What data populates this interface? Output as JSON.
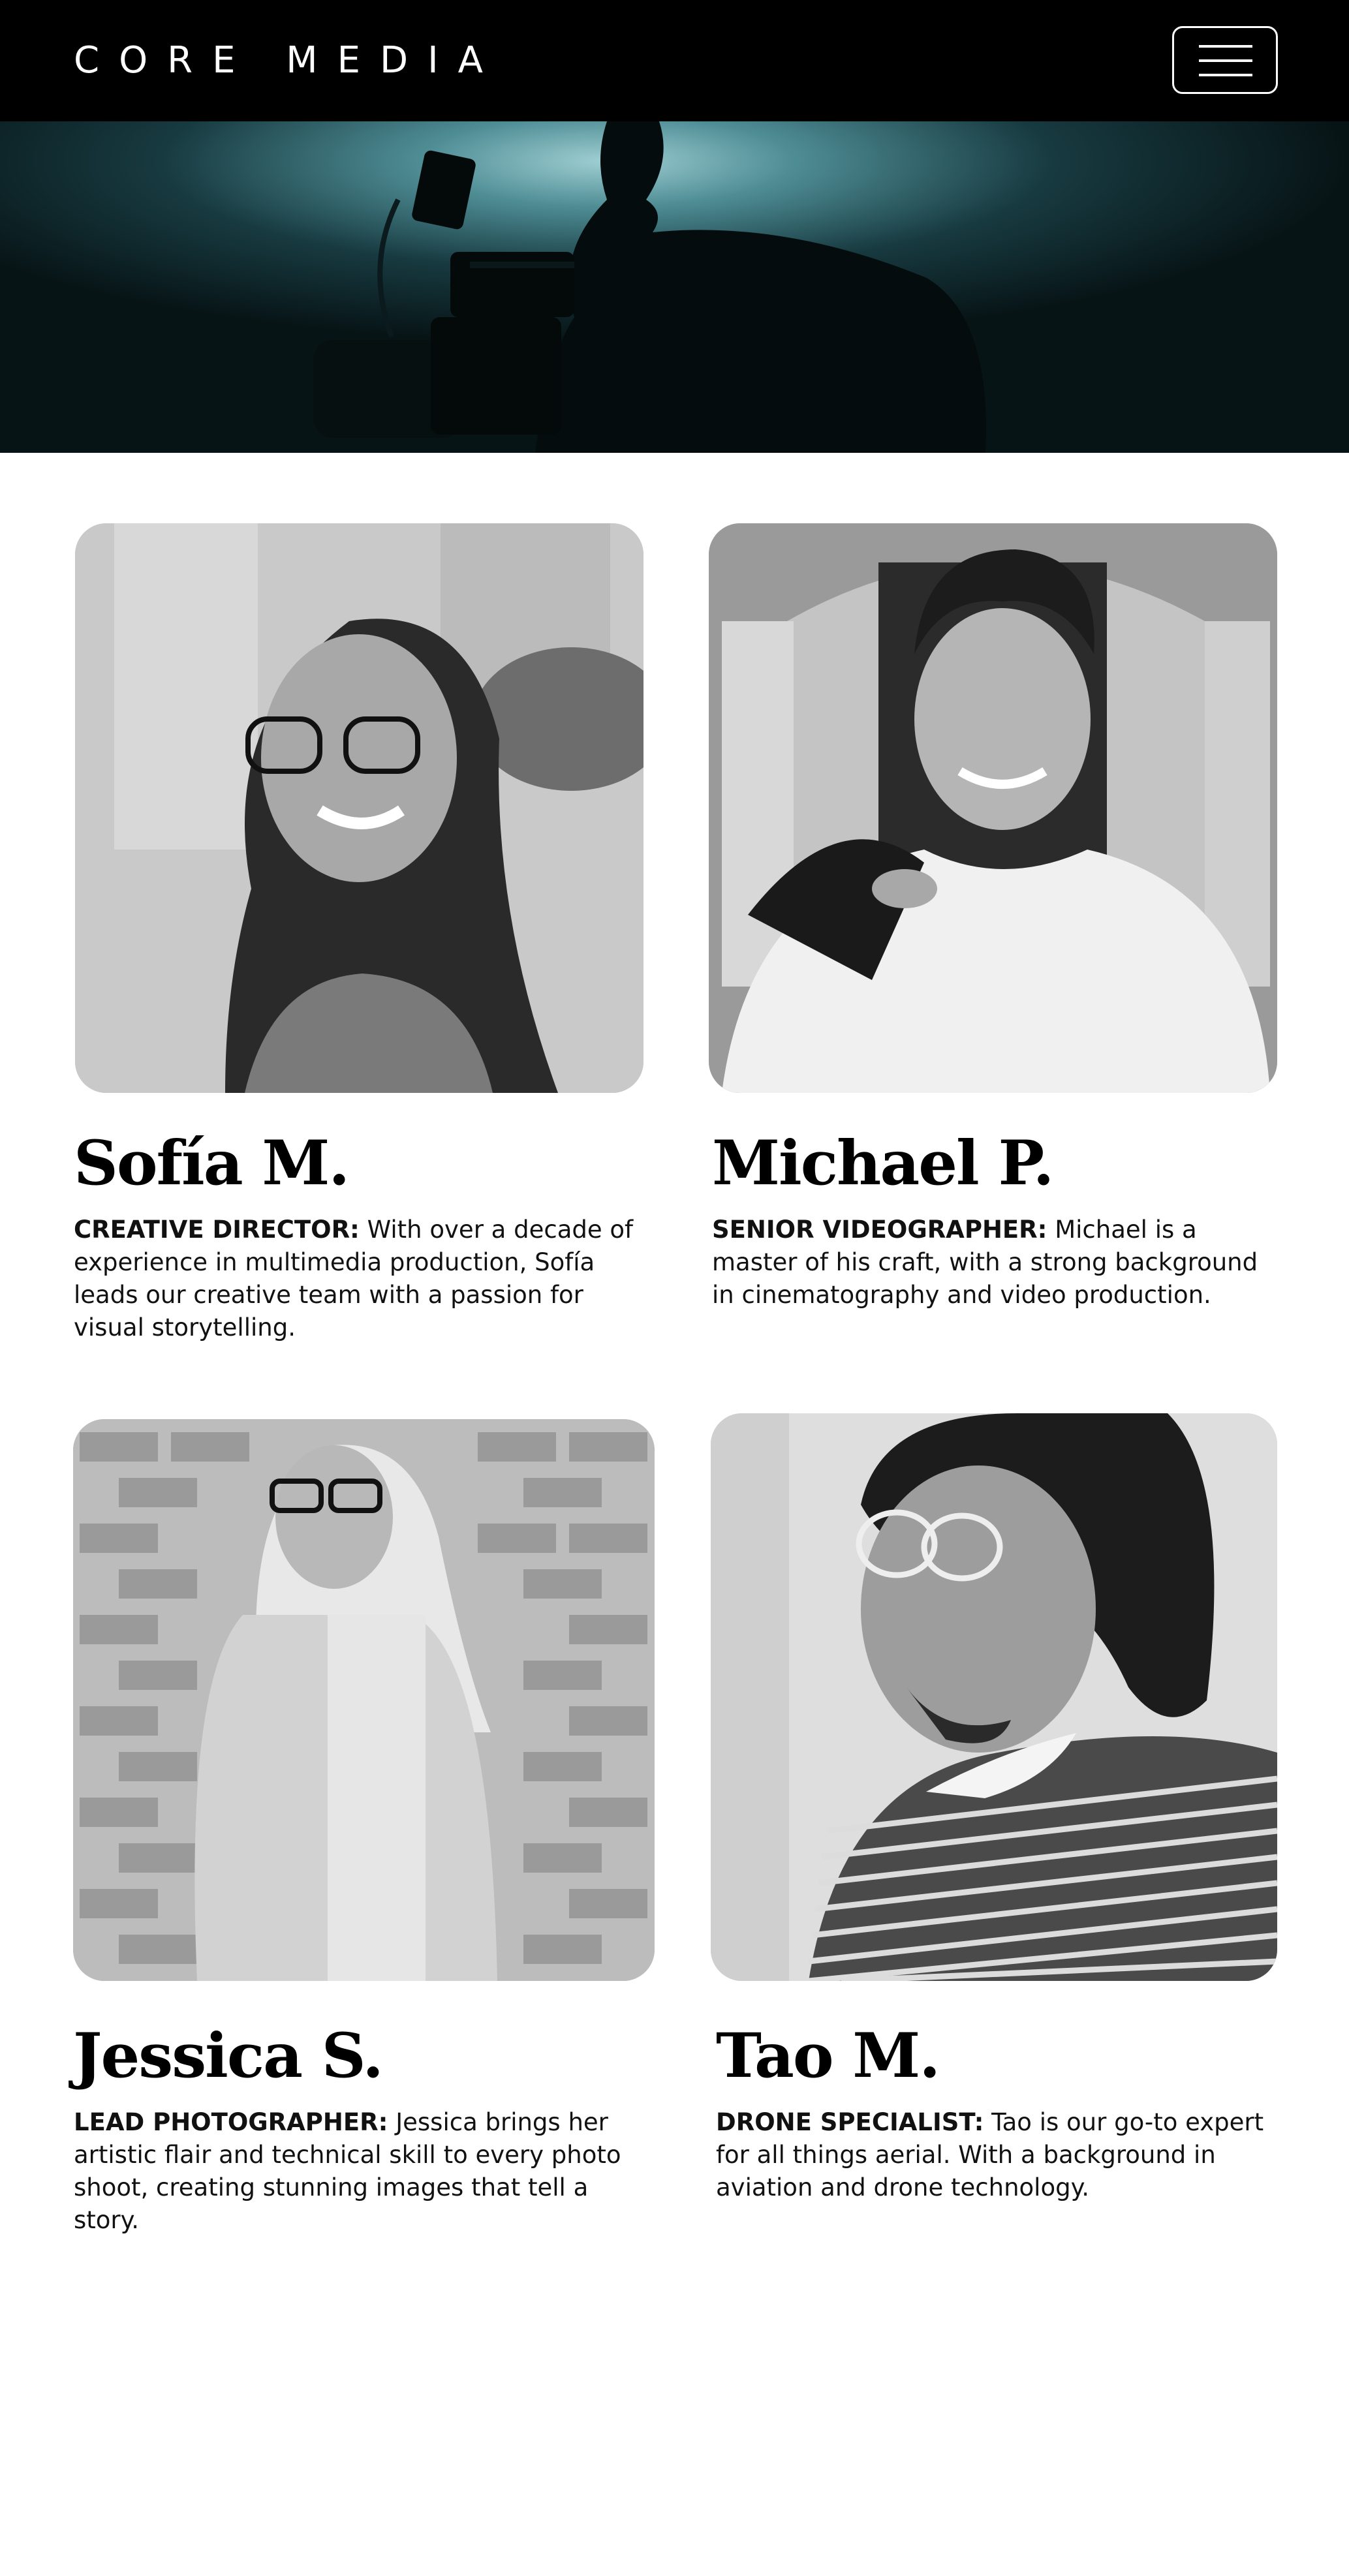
{
  "header": {
    "logo": "CORE MEDIA",
    "menu_icon": "hamburger-menu-icon",
    "background": "#000000"
  },
  "hero": {
    "image": "videographer-silhouette-photo",
    "tint": "#3a6f76"
  },
  "team": [
    {
      "name": "Sofía M.",
      "role": "CREATIVE DIRECTOR:",
      "bio": " With over a decade of experience in multimedia production, Sofía leads our creative team with a passion for visual storytelling.",
      "photo": "portrait-sofia"
    },
    {
      "name": "Michael P.",
      "role": "SENIOR VIDEOGRAPHER:",
      "bio": " Michael is a master of his craft, with a strong background in cinematography and video production.",
      "photo": "portrait-michael"
    },
    {
      "name": "Jessica S.",
      "role": "LEAD PHOTOGRAPHER:",
      "bio": " Jessica brings her artistic flair and technical skill to every photo shoot, creating stunning images that tell a story.",
      "photo": "portrait-jessica"
    },
    {
      "name": "Tao M.",
      "role": "DRONE SPECIALIST:",
      "bio": " Tao is our go-to expert for all things aerial. With a background in aviation and drone technology.",
      "photo": "portrait-tao"
    }
  ]
}
